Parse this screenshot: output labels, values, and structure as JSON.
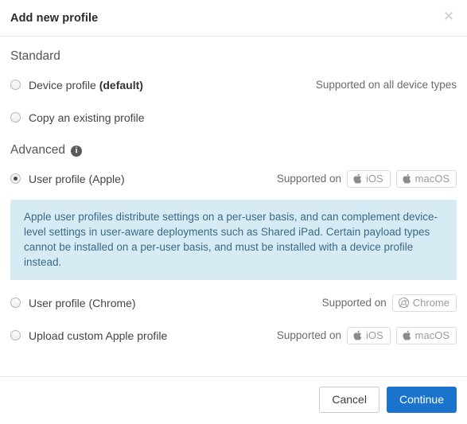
{
  "dialog": {
    "title": "Add new profile",
    "close_icon": "close-icon"
  },
  "sections": {
    "standard": {
      "heading": "Standard",
      "options": [
        {
          "label_plain": "Device profile ",
          "label_bold": "(default)",
          "selected": false,
          "supported_text": "Supported on all device types",
          "badges": []
        },
        {
          "label_plain": "Copy an existing profile",
          "label_bold": "",
          "selected": false,
          "supported_text": "",
          "badges": []
        }
      ]
    },
    "advanced": {
      "heading": "Advanced",
      "info_icon": "info-icon",
      "options": [
        {
          "label_plain": "User profile (Apple)",
          "label_bold": "",
          "selected": true,
          "supported_text": "Supported on",
          "badges": [
            {
              "icon": "apple-icon",
              "label": "iOS"
            },
            {
              "icon": "apple-icon",
              "label": "macOS"
            }
          ]
        },
        {
          "label_plain": "User profile (Chrome)",
          "label_bold": "",
          "selected": false,
          "supported_text": "Supported on",
          "badges": [
            {
              "icon": "chrome-icon",
              "label": "Chrome"
            }
          ]
        },
        {
          "label_plain": "Upload custom Apple profile",
          "label_bold": "",
          "selected": false,
          "supported_text": "Supported on",
          "badges": [
            {
              "icon": "apple-icon",
              "label": "iOS"
            },
            {
              "icon": "apple-icon",
              "label": "macOS"
            }
          ]
        }
      ],
      "callout": "Apple user profiles distribute settings on a per-user basis, and can complement device-level settings in user-aware deployments such as Shared iPad. Certain payload types cannot be installed on a per-user basis, and must be installed with a device profile instead."
    }
  },
  "footer": {
    "cancel_label": "Cancel",
    "continue_label": "Continue"
  },
  "colors": {
    "primary_button": "#1a73cc",
    "callout_background": "#d7ebf4",
    "callout_text": "#3a6a86",
    "divider": "#e5e5e5"
  }
}
